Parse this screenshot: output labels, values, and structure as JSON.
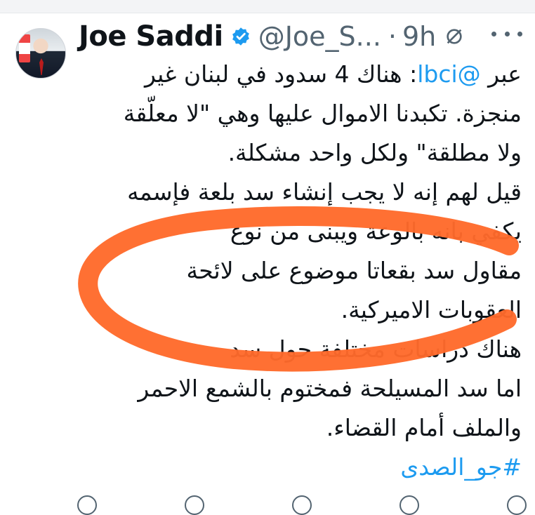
{
  "tweet": {
    "author": {
      "name": "Joe Saddi",
      "handle": "@Joe_S...",
      "separator": "·",
      "time": "9h",
      "verified": true
    },
    "lines": [
      {
        "parts": [
          {
            "text": "عبر "
          },
          {
            "text": "@lbci",
            "type": "mention"
          },
          {
            "text": ": هناك 4 سدود في لبنان غير"
          }
        ]
      },
      {
        "parts": [
          {
            "text": "منجزة. تكبدنا الاموال عليها وهي \"لا معلّقة"
          }
        ]
      },
      {
        "parts": [
          {
            "text": "ولا مطلقة\" ولكل واحد مشكلة."
          }
        ]
      },
      {
        "parts": [
          {
            "text": " قيل لهم إنه لا يجب إنشاء سد بلعة فإسمه"
          }
        ]
      },
      {
        "parts": [
          {
            "text": "يكفي بانه بالوعة ويبنى من نوع"
          }
        ]
      },
      {
        "parts": [
          {
            "text": "مقاول سد بقعاتا موضوع على لائحة"
          }
        ]
      },
      {
        "parts": [
          {
            "text": "العقوبات الاميركية."
          }
        ]
      },
      {
        "parts": [
          {
            "text": "هناك دراسات مختلفة حول سد"
          }
        ]
      },
      {
        "parts": [
          {
            "text": "اما سد المسيلحة فمختوم بالشمع الاحمر"
          }
        ]
      },
      {
        "parts": [
          {
            "text": "والملف أمام القضاء."
          }
        ]
      }
    ],
    "hashtag": "#جو_الصدى",
    "annotation_color": "#ff6a2b",
    "link_color": "#1d9bf0"
  },
  "icons": {
    "verified": "verified-badge-icon",
    "edited": "edited-icon",
    "more": "more-icon",
    "reply": "reply-icon",
    "retweet": "retweet-icon",
    "like": "like-icon",
    "views": "views-icon",
    "share": "share-icon"
  }
}
